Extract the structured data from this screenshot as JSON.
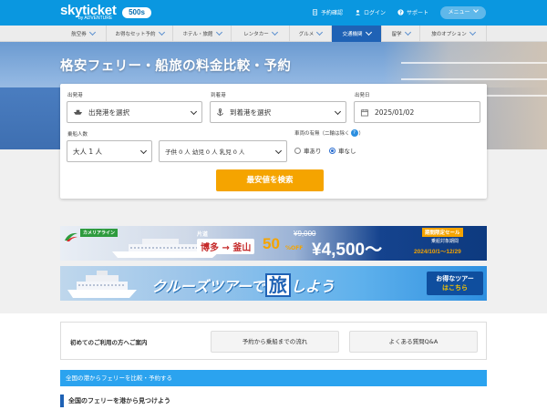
{
  "header": {
    "logo": "skyticket",
    "logo_sub": "by ADVENTURE",
    "badge": "500s",
    "links": [
      {
        "label": "予約確認",
        "icon": "document-icon"
      },
      {
        "label": "ログイン",
        "icon": "user-icon"
      },
      {
        "label": "サポート",
        "icon": "help-icon"
      }
    ],
    "menu_label": "メニュー"
  },
  "nav": {
    "items": [
      {
        "label": "航空券"
      },
      {
        "label": "お得なセット予約"
      },
      {
        "label": "ホテル・旅館"
      },
      {
        "label": "レンタカー"
      },
      {
        "label": "グルメ"
      },
      {
        "label": "交通機関"
      },
      {
        "label": "留学"
      },
      {
        "label": "旅のオプション"
      }
    ],
    "active_index": 5
  },
  "hero": {
    "title": "格安フェリー・船旅の料金比較・予約"
  },
  "search": {
    "departure_label": "出発港",
    "departure_value": "出発港を選択",
    "arrival_label": "到着港",
    "arrival_value": "到着港を選択",
    "date_label": "出発日",
    "date_value": "2025/01/02",
    "passengers_label": "乗船人数",
    "adults_value": "大人 1 人",
    "children_value": "子供 0 人 幼児 0 人 乳児 0 人",
    "vehicle_label": "車両の有無（二輪は除く",
    "vehicle_help": "?",
    "vehicle_yes": "車あり",
    "vehicle_no": "車なし",
    "vehicle_selected": "車なし",
    "submit_label": "最安値を検索"
  },
  "banners": {
    "ferry_banner": {
      "company": "カメリアライン",
      "trip_type": "片道",
      "route": "博多 → 釜山",
      "discount": "50",
      "discount_unit": "%OFF",
      "old_price": "¥9,000",
      "new_price": "¥4,500〜",
      "sale_label": "期間限定セール",
      "period_label": "乗船対象期間",
      "period": "2024/10/1〜12/29"
    },
    "cruise_banner": {
      "text_before": "クルーズツアーで",
      "text_highlight": "旅",
      "text_after": "しよう",
      "cta_line1": "お得なツアー",
      "cta_line2": "はこちら"
    }
  },
  "guide": {
    "title": "初めてのご利用の方へご案内",
    "button1": "予約から乗船までの流れ",
    "button2": "よくある質問Q&A"
  },
  "compare_bar": "全国の港からフェリーを比較・予約する",
  "section_heading": "全国のフェリーを港から見つけよう"
}
